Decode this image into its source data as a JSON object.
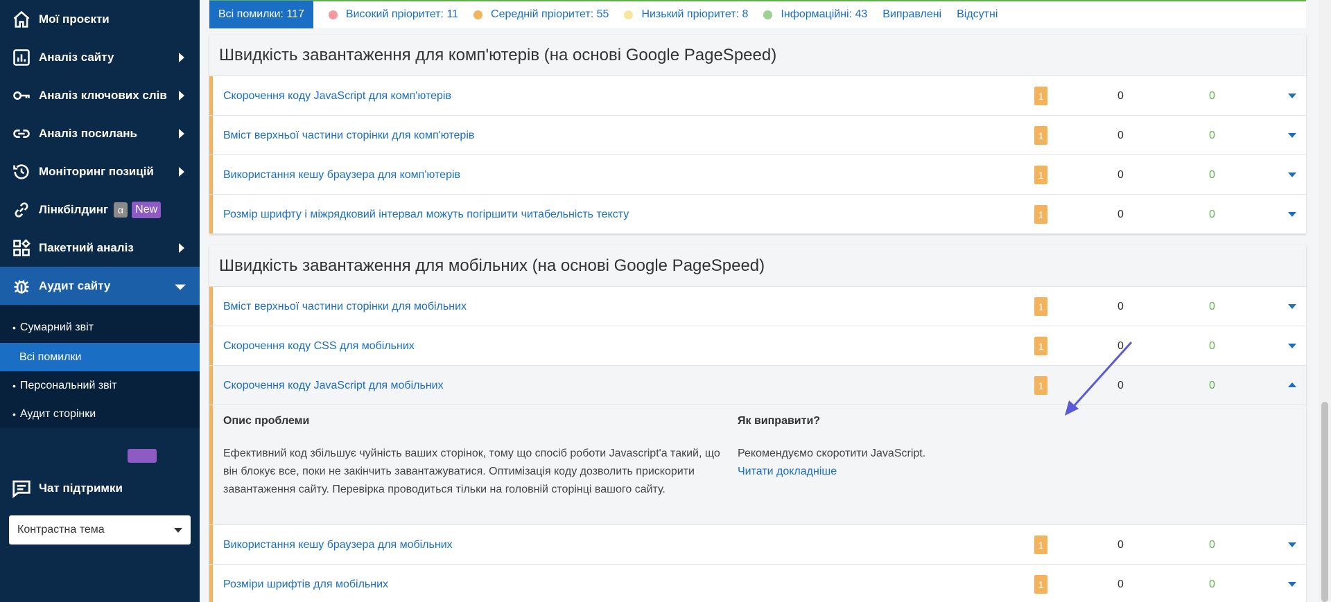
{
  "sidebar": {
    "items": [
      {
        "label": "Мої проєкти",
        "icon": "home-icon"
      },
      {
        "label": "Аналіз сайту",
        "icon": "chart-icon"
      },
      {
        "label": "Аналіз ключових слів",
        "icon": "key-icon"
      },
      {
        "label": "Аналіз посилань",
        "icon": "link-icon"
      },
      {
        "label": "Моніторинг позицій",
        "icon": "history-icon"
      },
      {
        "label": "Лінкбілдинг",
        "icon": "chain-icon",
        "alpha_badge": "α",
        "new_badge": "New"
      },
      {
        "label": "Пакетний аналіз",
        "icon": "grid-icon"
      },
      {
        "label": "Аудит сайту",
        "icon": "bug-icon"
      }
    ],
    "subitems": [
      {
        "label": "Сумарний звіт"
      },
      {
        "label": "Всі помилки"
      },
      {
        "label": "Персональний звіт"
      },
      {
        "label": "Аудит сторінки"
      }
    ],
    "support_label": "Чат підтримки",
    "theme_select": "Контрастна тема"
  },
  "filters": {
    "all": "Всі помилки: 117",
    "high": "Високий пріоритет: 11",
    "medium": "Середній пріоритет: 55",
    "low": "Низький пріоритет: 8",
    "info": "Інформаційні: 43",
    "fixed": "Виправлені",
    "missing": "Відсутні",
    "colors": {
      "high": "#f59aa0",
      "medium": "#f2b35c",
      "low": "#f5e7a0",
      "info": "#9ed08f"
    }
  },
  "desktop": {
    "title": "Швидкість завантаження для комп'ютерів (на основі Google PageSpeed)",
    "rows": [
      {
        "title": "Скорочення коду JavaScript для комп'ютерів",
        "count": "1",
        "fixed": "0",
        "missing": "0"
      },
      {
        "title": "Вміст верхньої частини сторінки для комп'ютерів",
        "count": "1",
        "fixed": "0",
        "missing": "0"
      },
      {
        "title": "Використання кешу браузера для комп'ютерів",
        "count": "1",
        "fixed": "0",
        "missing": "0"
      },
      {
        "title": "Розмір шрифту і міжрядковий інтервал можуть погіршити читабельність тексту",
        "count": "1",
        "fixed": "0",
        "missing": "0"
      }
    ]
  },
  "mobile": {
    "title": "Швидкість завантаження для мобільних (на основі Google PageSpeed)",
    "rows": [
      {
        "title": "Вміст верхньої частини сторінки для мобільних",
        "count": "1",
        "fixed": "0",
        "missing": "0"
      },
      {
        "title": "Скорочення коду CSS для мобільних",
        "count": "1",
        "fixed": "0",
        "missing": "0"
      },
      {
        "title": "Скорочення коду JavaScript для мобільних",
        "count": "1",
        "fixed": "0",
        "missing": "0"
      },
      {
        "title": "Використання кешу браузера для мобільних",
        "count": "1",
        "fixed": "0",
        "missing": "0"
      },
      {
        "title": "Розміри шрифтів для мобільних",
        "count": "1",
        "fixed": "0",
        "missing": "0"
      }
    ],
    "details": {
      "problem_heading": "Опис проблеми",
      "problem_text": "Ефективний код збільшує чуйність ваших сторінок, тому що спосіб роботи Javascript'а такий, що він блокує все, поки не закінчить завантажуватися. Оптимізація коду дозволить прискорити завантаження сайту. Перевірка проводиться тільки на головній сторінці вашого сайту.",
      "fix_heading": "Як виправити?",
      "fix_text": "Рекомендуємо скоротити JavaScript.",
      "fix_link": "Читати докладніше"
    }
  }
}
